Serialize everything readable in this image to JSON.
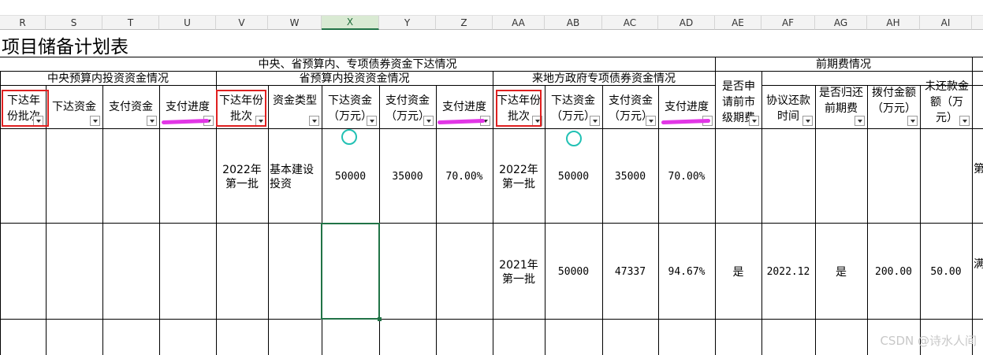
{
  "columns": [
    "R",
    "S",
    "T",
    "U",
    "V",
    "W",
    "X",
    "Y",
    "Z",
    "AA",
    "AB",
    "AC",
    "AD",
    "AE",
    "AF",
    "AG",
    "AH",
    "AI"
  ],
  "title": "项目储备计划表",
  "group_headers": {
    "main": "中央、省预算内、专项债券资金下达情况",
    "central": "中央预算内投资资金情况",
    "provincial": "省预算内投资资金情况",
    "local_bond": "来地方政府专项债券资金情况",
    "preliminary": "前期费情况"
  },
  "field_headers": {
    "R": "下达年份批次",
    "S": "下达资金",
    "T": "支付资金",
    "U": "支付进度",
    "V": "下达年份批次",
    "W": "资金类型",
    "X": "下达资金（万元）",
    "Y": "支付资金（万元）",
    "Z": "支付进度",
    "AA": "下达年份批次",
    "AB": "下达资金（万元）",
    "AC": "支付资金（万元）",
    "AD": "支付进度",
    "AE": "是否申请前市级期费",
    "AF": "协议还款时间",
    "AG": "是否归还前期费",
    "AH": "拨付金额（万元）",
    "AI": "未还款金额（万元）"
  },
  "rows": [
    {
      "V": "2022年第一批",
      "W": "基本建设投资",
      "X": "50000",
      "Y": "35000",
      "Z": "70.00%",
      "AA": "2022年第一批",
      "AB": "50000",
      "AC": "35000",
      "AD": "70.00%",
      "edge": "第"
    },
    {
      "AA": "2021年第一批",
      "AB": "50000",
      "AC": "47337",
      "AD": "94.67%",
      "AE": "是",
      "AF": "2022.12",
      "AG": "是",
      "AH": "200.00",
      "AI": "50.00",
      "edge": "满"
    }
  ],
  "selected_column": "X",
  "watermark": "CSDN @诗水人间",
  "colors": {
    "annotation_red": "#e02020",
    "annotation_pink": "#e236e6",
    "annotation_cyan": "#22c1b4",
    "selection_green": "#217346"
  }
}
